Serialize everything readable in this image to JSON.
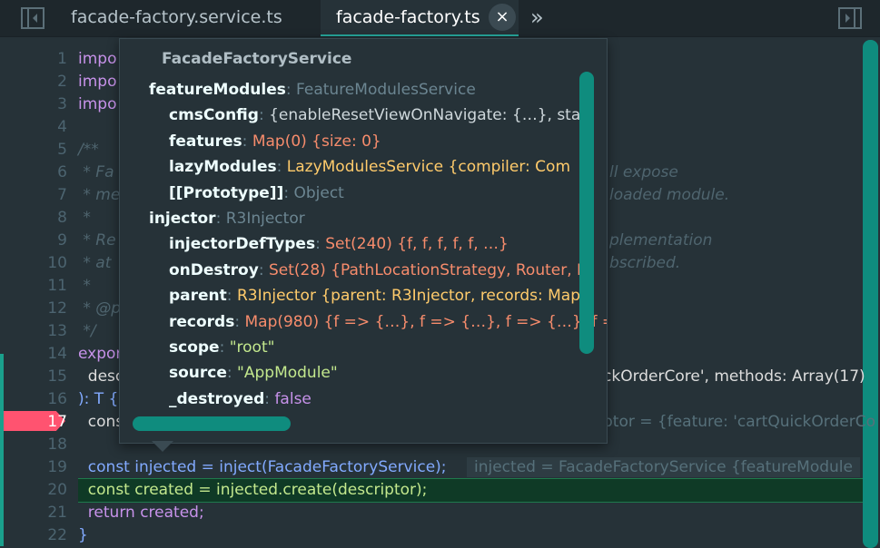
{
  "tabs": {
    "inactive": "facade-factory.service.ts",
    "active": "facade-factory.ts",
    "close": "×",
    "more": "»"
  },
  "colors": {
    "accent": "#26a69a",
    "background": "#263238",
    "breakpoint": "#ff5370",
    "highlight_line": "#0f3a26"
  },
  "icons": [
    "collapse-sidebar-icon",
    "close-icon",
    "chevron-double-right-icon",
    "split-editor-icon"
  ],
  "popup": {
    "title": "FacadeFactoryService",
    "rows": [
      {
        "indent": 0,
        "key": "featureModules",
        "sep": ": ",
        "value": "FeatureModulesService",
        "value_cls": "t"
      },
      {
        "indent": 1,
        "key": "cmsConfig",
        "sep": ": ",
        "value": "{enableResetViewOnNavigate: {…}, stat",
        "value_cls": "v-w"
      },
      {
        "indent": 1,
        "key": "features",
        "sep": ": ",
        "value": "Map(0) {size: 0}",
        "value_cls": "v-or"
      },
      {
        "indent": 1,
        "key": "lazyModules",
        "sep": ": ",
        "value": "LazyModulesService {compiler: Com",
        "value_cls": "v-y"
      },
      {
        "indent": 1,
        "key": "[[Prototype]]",
        "sep": ": ",
        "value": "Object",
        "value_cls": "t"
      },
      {
        "indent": 0,
        "key": "injector",
        "sep": ": ",
        "value": "R3Injector",
        "value_cls": "t"
      },
      {
        "indent": 1,
        "key": "injectorDefTypes",
        "sep": ": ",
        "value": "Set(240) {f, f, f, f, f, …}",
        "value_cls": "v-or"
      },
      {
        "indent": 1,
        "key": "onDestroy",
        "sep": ": ",
        "value": "Set(28) {PathLocationStrategy, Router, I",
        "value_cls": "v-or"
      },
      {
        "indent": 1,
        "key": "parent",
        "sep": ": ",
        "value": "R3Injector {parent: R3Injector, records: Map",
        "value_cls": "v-y"
      },
      {
        "indent": 1,
        "key": "records",
        "sep": ": ",
        "value": "Map(980) {f => {…}, f => {…}, f => {…}, f =>",
        "value_cls": "v-or"
      },
      {
        "indent": 1,
        "key": "scope",
        "sep": ": ",
        "value": "\"root\"",
        "value_cls": "v-g"
      },
      {
        "indent": 1,
        "key": "source",
        "sep": ": ",
        "value": "\"AppModule\"",
        "value_cls": "v-g"
      },
      {
        "indent": 1,
        "key": "_destroyed",
        "sep": ": ",
        "value": "false",
        "value_cls": "v-p"
      }
    ]
  },
  "code": {
    "lines": [
      {
        "n": "1",
        "text": "impo"
      },
      {
        "n": "2",
        "text": "impo"
      },
      {
        "n": "3",
        "text": "impo"
      },
      {
        "n": "4",
        "text": ""
      },
      {
        "n": "5",
        "text": "/**"
      },
      {
        "n": "6",
        "text": " * Fa",
        "tail": "ll expose"
      },
      {
        "n": "7",
        "text": " * me",
        "tail": "loaded module."
      },
      {
        "n": "8",
        "text": " *"
      },
      {
        "n": "9",
        "text": " * Re",
        "tail": "plementation"
      },
      {
        "n": "10",
        "text": " * at",
        "tail": "bscribed."
      },
      {
        "n": "11",
        "text": " *"
      },
      {
        "n": "12",
        "text": " * @p"
      },
      {
        "n": "13",
        "text": " */"
      },
      {
        "n": "14",
        "text": "expor"
      },
      {
        "n": "15",
        "text": "  desc",
        "tail": "ckOrderCore', methods: Array(17)"
      },
      {
        "n": "16",
        "text": "): T {"
      },
      {
        "n": "17",
        "text": "  cons",
        "tail": "ptor = {feature: 'cartQuickOrderCo"
      },
      {
        "n": "18",
        "text": ""
      },
      {
        "n": "19",
        "text": "  const injected = inject(FacadeFactoryService);",
        "tail": "injected = FacadeFactoryService {featureModule"
      },
      {
        "n": "20",
        "text": "  const created = injected.create(descriptor);"
      },
      {
        "n": "21",
        "text": "  return created;"
      },
      {
        "n": "22",
        "text": "}"
      }
    ]
  }
}
